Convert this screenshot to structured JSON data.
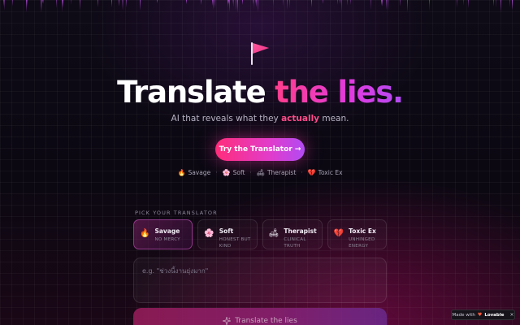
{
  "hero": {
    "title_part1": "Translate",
    "title_part2": "the lies.",
    "subtitle_before": "AI that reveals what they ",
    "subtitle_highlight": "actually",
    "subtitle_after": " mean."
  },
  "cta": {
    "label": "Try the Translator →"
  },
  "modes_line": [
    {
      "emoji": "🔥",
      "label": "Savage"
    },
    {
      "emoji": "🌸",
      "label": "Soft"
    },
    {
      "emoji": "🛋",
      "label": "Therapist"
    },
    {
      "emoji": "💔",
      "label": "Toxic Ex"
    }
  ],
  "picker": {
    "label": "PICK YOUR TRANSLATOR",
    "cards": [
      {
        "emoji": "🔥",
        "name": "Savage",
        "desc": "NO MERCY",
        "active": true
      },
      {
        "emoji": "🌸",
        "name": "Soft",
        "desc": "HONEST BUT KIND",
        "active": false
      },
      {
        "emoji": "🛋",
        "name": "Therapist",
        "desc": "CLINICAL TRUTH",
        "active": false
      },
      {
        "emoji": "💔",
        "name": "Toxic Ex",
        "desc": "UNHINGED ENERGY",
        "active": false
      }
    ]
  },
  "input": {
    "placeholder": "e.g. \"ช่วงนี้งานยุ่งมาก\"",
    "value": ""
  },
  "translate_button": {
    "label": "Translate the lies",
    "icon": "sparkles-icon"
  },
  "badge": {
    "prefix": "Made with",
    "brand": "Lovable",
    "close": "×"
  },
  "icons": {
    "flag": "flag-icon"
  },
  "colors": {
    "accent_pink": "#ff2d7a",
    "accent_magenta": "#e23cc9",
    "accent_purple": "#b24bf3",
    "background": "#0b0812"
  }
}
